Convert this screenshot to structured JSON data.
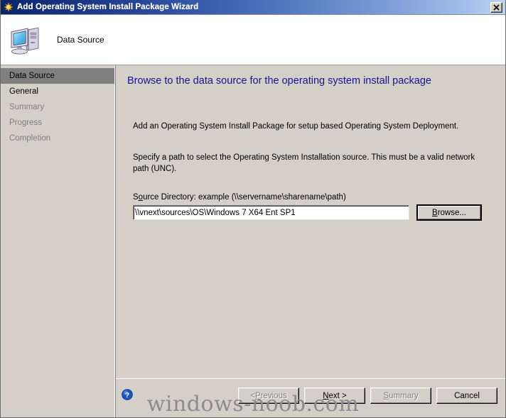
{
  "window": {
    "title": "Add Operating System Install Package Wizard",
    "title_icon": "wizard-star-icon",
    "close_label": "✕"
  },
  "header": {
    "icon": "computer-icon",
    "title": "Data Source"
  },
  "sidebar": {
    "items": [
      {
        "label": "Data Source",
        "state": "selected"
      },
      {
        "label": "General",
        "state": "active"
      },
      {
        "label": "Summary",
        "state": "dim"
      },
      {
        "label": "Progress",
        "state": "dim"
      },
      {
        "label": "Completion",
        "state": "dim"
      }
    ]
  },
  "content": {
    "heading": "Browse to the data source for the operating system install package",
    "paragraph1": "Add an Operating System Install Package for setup based Operating System Deployment.",
    "paragraph2": "Specify a path to select the Operating System Installation source. This must be a valid network path (UNC).",
    "field_label_prefix": "S",
    "field_label_accel": "o",
    "field_label_suffix": "urce Directory: example (\\\\servername\\sharename\\path)",
    "path_value": "\\\\vnext\\sources\\OS\\Windows 7 X64 Ent SP1",
    "path_placeholder": "\\\\servername\\sharename\\path",
    "browse_prefix": "",
    "browse_accel": "B",
    "browse_suffix": "rowse..."
  },
  "footer": {
    "help_icon": "help-question-icon",
    "buttons": [
      {
        "label": "< Previous",
        "accel": "P",
        "prefix": "< ",
        "suffix": "revious",
        "enabled": false
      },
      {
        "label": "Next >",
        "accel": "N",
        "prefix": "",
        "suffix": "ext >",
        "enabled": true
      },
      {
        "label": "Summary",
        "accel": "S",
        "prefix": "",
        "suffix": "ummary",
        "enabled": false
      },
      {
        "label": "Cancel",
        "accel": "",
        "prefix": "Cancel",
        "suffix": "",
        "enabled": true
      }
    ]
  },
  "watermark": {
    "text": "windows-noob.com"
  },
  "colors": {
    "titlebar_start": "#0a246a",
    "titlebar_end": "#bcd3f2",
    "dialog_face": "#d4d0c8",
    "heading_blue": "#141499",
    "selected_nav": "#808080",
    "dim_text": "#808080"
  }
}
